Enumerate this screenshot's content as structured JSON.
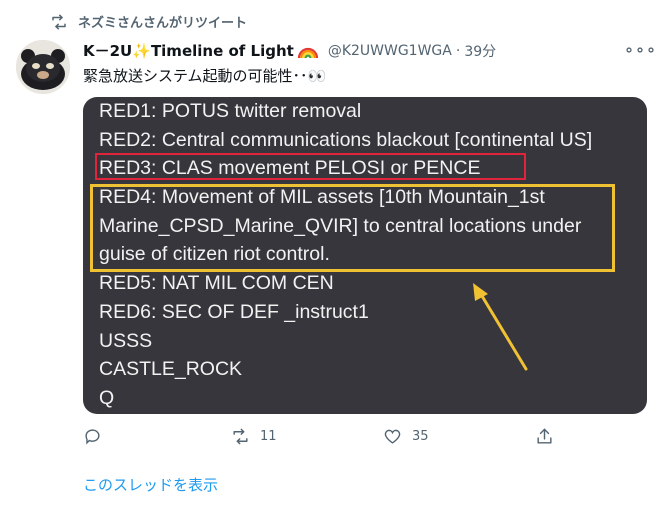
{
  "retweet": {
    "label": "ネズミさんさんがリツイート",
    "icon": "retweet-icon"
  },
  "author": {
    "name_prefix": "K－2U",
    "name_star": "✨",
    "name_suffix": "Timeline of Light",
    "handle": "@K2UWWG1WGA",
    "separator": "·",
    "time": "39分"
  },
  "more_label": "∘∘∘",
  "tweet_text": "緊急放送システム起動の可能性･･👀",
  "media": {
    "lines": [
      "RED1: POTUS twitter removal",
      "RED2: Central communications blackout [continental US]",
      "RED3: CLAS movement PELOSI or PENCE",
      "RED4: Movement of MIL assets [10th Mountain_1st",
      "Marine_CPSD_Marine_QVIR] to central locations under",
      "guise of citizen riot control.",
      "RED5: NAT MIL COM CEN",
      "RED6: SEC OF DEF _instruct1",
      "USSS",
      "CASTLE_ROCK",
      "Q"
    ],
    "highlight_red": "#e0243c",
    "highlight_yellow": "#f0c233"
  },
  "actions": {
    "reply_count": "",
    "retweet_count": "11",
    "like_count": "35"
  },
  "thread_link": "このスレッドを表示",
  "colors": {
    "link": "#1d9bf0",
    "muted": "#536471",
    "media_bg": "#36363c"
  }
}
